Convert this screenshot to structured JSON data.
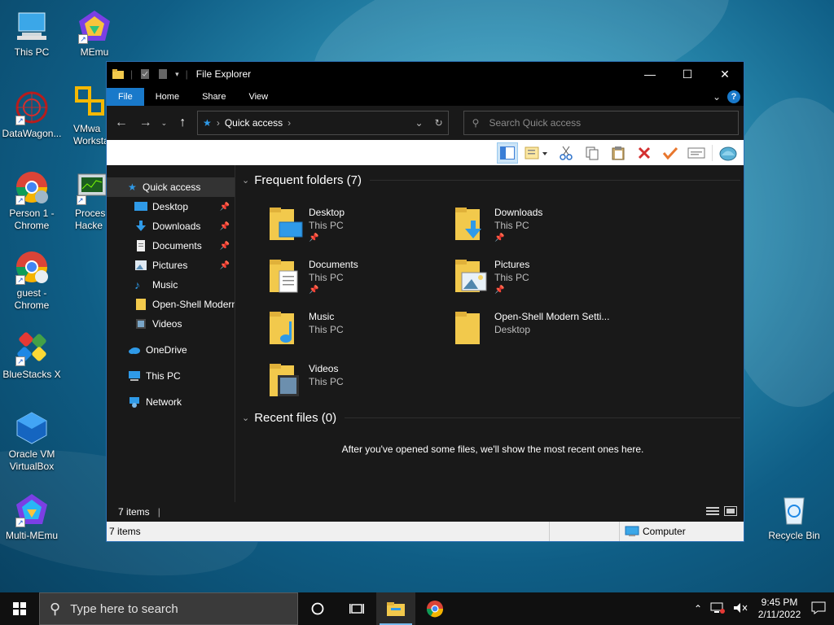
{
  "desktop": {
    "icons": [
      {
        "label": "This PC"
      },
      {
        "label": "MEmu"
      },
      {
        "label": "DataWagon..."
      },
      {
        "label": "VMwa\nWorksta"
      },
      {
        "label": "Person 1 -\nChrome"
      },
      {
        "label": "Proces\nHacke"
      },
      {
        "label": "guest -\nChrome"
      },
      {
        "label": "BlueStacks X"
      },
      {
        "label": "Oracle VM\nVirtualBox"
      },
      {
        "label": "Multi-MEmu"
      },
      {
        "label": "Recycle Bin"
      }
    ]
  },
  "window": {
    "title": "File Explorer",
    "controls": {
      "minimize": "—",
      "maximize": "☐",
      "close": "✕"
    },
    "ribbon_tabs": [
      "File",
      "Home",
      "Share",
      "View"
    ],
    "help": "?",
    "address": {
      "location": "Quick access"
    },
    "search": {
      "placeholder": "Search Quick access"
    },
    "nav": {
      "quick_access": "Quick access",
      "items": [
        {
          "label": "Desktop",
          "pinned": true,
          "icon": "desktop-icon"
        },
        {
          "label": "Downloads",
          "pinned": true,
          "icon": "downloads-icon"
        },
        {
          "label": "Documents",
          "pinned": true,
          "icon": "documents-icon"
        },
        {
          "label": "Pictures",
          "pinned": true,
          "icon": "pictures-icon"
        },
        {
          "label": "Music",
          "pinned": false,
          "icon": "music-icon"
        },
        {
          "label": "Open-Shell Modern",
          "pinned": false,
          "icon": "folder-icon"
        },
        {
          "label": "Videos",
          "pinned": false,
          "icon": "videos-icon"
        }
      ],
      "onedrive": "OneDrive",
      "this_pc": "This PC",
      "network": "Network"
    },
    "frequent": {
      "header": "Frequent folders (7)",
      "folders": [
        {
          "name": "Desktop",
          "location": "This PC",
          "pinned": true
        },
        {
          "name": "Downloads",
          "location": "This PC",
          "pinned": true
        },
        {
          "name": "Documents",
          "location": "This PC",
          "pinned": true
        },
        {
          "name": "Pictures",
          "location": "This PC",
          "pinned": true
        },
        {
          "name": "Music",
          "location": "This PC",
          "pinned": false
        },
        {
          "name": "Open-Shell Modern Setti...",
          "location": "Desktop",
          "pinned": false
        },
        {
          "name": "Videos",
          "location": "This PC",
          "pinned": false
        }
      ]
    },
    "recent": {
      "header": "Recent files (0)",
      "empty_message": "After you've opened some files, we'll show the most recent ones here."
    },
    "status": {
      "items_count": "7 items",
      "items_count_bar": "7 items",
      "computer": "Computer"
    }
  },
  "taskbar": {
    "search_placeholder": "Type here to search",
    "time": "9:45 PM",
    "date": "2/11/2022"
  },
  "colors": {
    "accent": "#1979ca",
    "folder": "#f2c94c"
  }
}
